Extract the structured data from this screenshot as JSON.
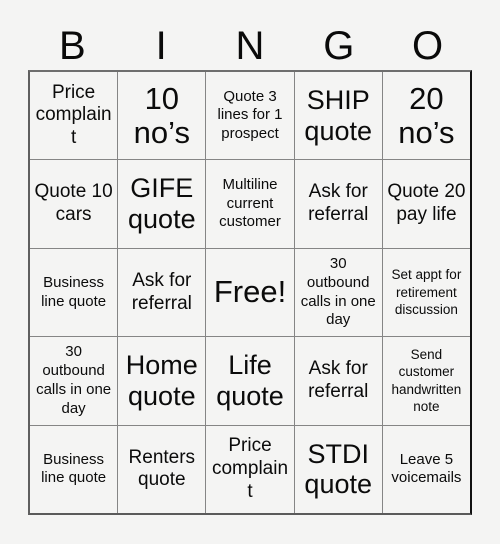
{
  "card": {
    "header_letters": [
      "B",
      "I",
      "N",
      "G",
      "O"
    ],
    "colors": {
      "background": "#f4f4f3",
      "text": "#0b0b0b",
      "inner_grid_line": "#858585",
      "outer_border": "#111111"
    },
    "grid": [
      [
        {
          "text": "Price complaint",
          "size": "md"
        },
        {
          "text": "10 no’s",
          "size": "xl"
        },
        {
          "text": "Quote 3 lines for 1 prospect",
          "size": "sm"
        },
        {
          "text": "SHIP quote",
          "size": "lg"
        },
        {
          "text": "20 no’s",
          "size": "xl"
        }
      ],
      [
        {
          "text": "Quote 10 cars",
          "size": "md"
        },
        {
          "text": "GIFE quote",
          "size": "lg"
        },
        {
          "text": "Multiline current customer",
          "size": "sm"
        },
        {
          "text": "Ask for referral",
          "size": "md"
        },
        {
          "text": "Quote 20 pay life",
          "size": "md"
        }
      ],
      [
        {
          "text": "Business line quote",
          "size": "sm"
        },
        {
          "text": "Ask for referral",
          "size": "md"
        },
        {
          "text": "Free!",
          "size": "xl"
        },
        {
          "text": "30 outbound calls in one day",
          "size": "sm"
        },
        {
          "text": "Set appt for retirement discussion",
          "size": "xs"
        }
      ],
      [
        {
          "text": "30 outbound calls in one day",
          "size": "sm"
        },
        {
          "text": "Home quote",
          "size": "lg"
        },
        {
          "text": "Life quote",
          "size": "lg"
        },
        {
          "text": "Ask for referral",
          "size": "md"
        },
        {
          "text": "Send customer handwritten note",
          "size": "xs"
        }
      ],
      [
        {
          "text": "Business line quote",
          "size": "sm"
        },
        {
          "text": "Renters quote",
          "size": "md"
        },
        {
          "text": "Price complaint",
          "size": "md"
        },
        {
          "text": "STDI quote",
          "size": "lg"
        },
        {
          "text": "Leave 5 voicemails",
          "size": "sm"
        }
      ]
    ]
  }
}
